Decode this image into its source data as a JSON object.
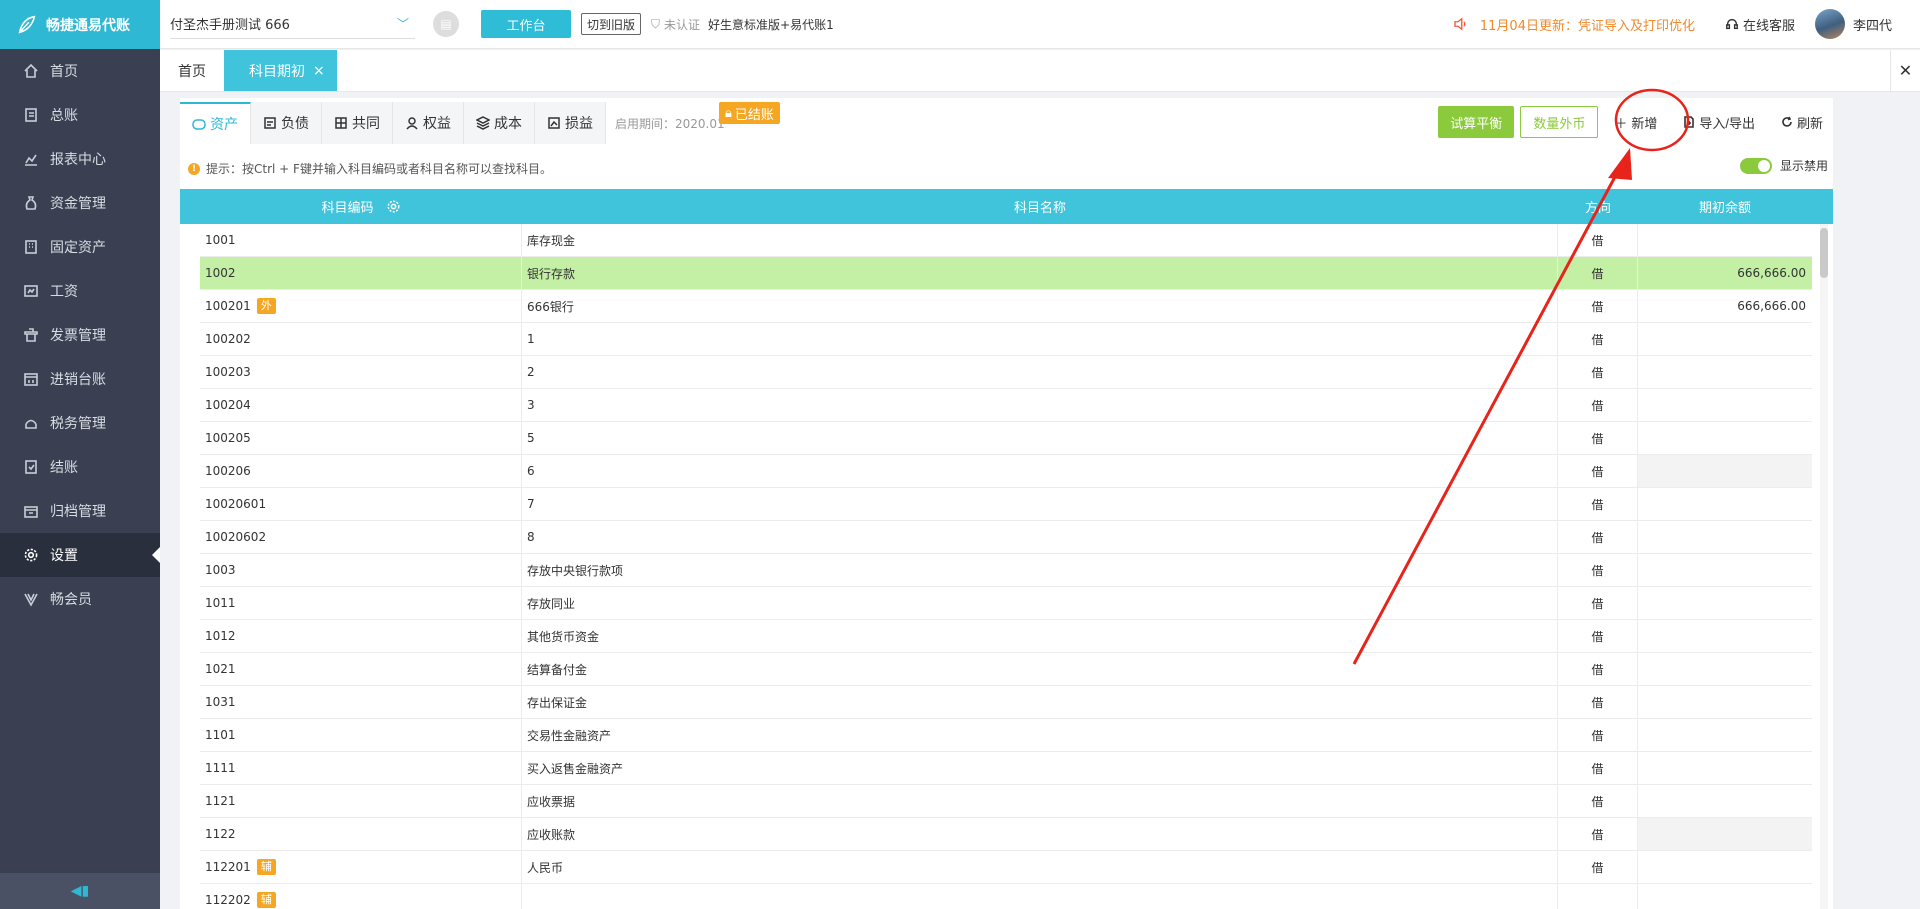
{
  "app": {
    "logo_text": "畅捷通易代账"
  },
  "sidebar": {
    "items": [
      {
        "label": "首页",
        "icon": "home-icon"
      },
      {
        "label": "总账",
        "icon": "ledger-icon"
      },
      {
        "label": "报表中心",
        "icon": "chart-icon"
      },
      {
        "label": "资金管理",
        "icon": "money-bag-icon"
      },
      {
        "label": "固定资产",
        "icon": "building-icon"
      },
      {
        "label": "工资",
        "icon": "payroll-icon"
      },
      {
        "label": "发票管理",
        "icon": "invoice-icon"
      },
      {
        "label": "进销台账",
        "icon": "register-icon"
      },
      {
        "label": "税务管理",
        "icon": "tax-icon"
      },
      {
        "label": "结账",
        "icon": "closing-icon"
      },
      {
        "label": "归档管理",
        "icon": "archive-icon"
      },
      {
        "label": "设置",
        "icon": "gear-icon",
        "active": true
      },
      {
        "label": "畅会员",
        "icon": "vip-icon"
      }
    ]
  },
  "topbar": {
    "company": "付圣杰手册测试 666",
    "workbench": "工作台",
    "old_version": "切到旧版",
    "cert_status": "未认证",
    "plan": "好生意标准版+易代账1",
    "notice": "11月04日更新：凭证导入及打印优化",
    "service": "在线客服",
    "user": "李四代"
  },
  "page_tabs": [
    {
      "label": "首页"
    },
    {
      "label": "科目期初",
      "active": true
    }
  ],
  "subtabs": [
    {
      "label": "资产",
      "active": true
    },
    {
      "label": "负债"
    },
    {
      "label": "共同"
    },
    {
      "label": "权益"
    },
    {
      "label": "成本"
    },
    {
      "label": "损益"
    }
  ],
  "period_label": "启用期间：2020.01",
  "closed_badge": "已结账",
  "actions": {
    "trial_balance": "试算平衡",
    "qty_fx": "数量外币",
    "add": "新增",
    "import_export": "导入/导出",
    "refresh": "刷新"
  },
  "hint": "提示：按Ctrl + F键并输入科目编码或者科目名称可以查找科目。",
  "toggle_label": "显示禁用",
  "table": {
    "headers": {
      "code": "科目编码",
      "name": "科目名称",
      "dir": "方向",
      "balance": "期初余额"
    },
    "rows": [
      {
        "code": "1001",
        "name": "库存现金",
        "dir": "借",
        "balance": ""
      },
      {
        "code": "1002",
        "name": "银行存款",
        "dir": "借",
        "balance": "666,666.00",
        "selected": true
      },
      {
        "code": "100201",
        "tag": "外",
        "name": "666银行",
        "dir": "借",
        "balance": "666,666.00"
      },
      {
        "code": "100202",
        "name": "1",
        "dir": "借",
        "balance": ""
      },
      {
        "code": "100203",
        "name": "2",
        "dir": "借",
        "balance": ""
      },
      {
        "code": "100204",
        "name": "3",
        "dir": "借",
        "balance": ""
      },
      {
        "code": "100205",
        "name": "5",
        "dir": "借",
        "balance": ""
      },
      {
        "code": "100206",
        "name": "6",
        "dir": "借",
        "balance": "",
        "shade": true
      },
      {
        "code": "10020601",
        "name": "7",
        "dir": "借",
        "balance": ""
      },
      {
        "code": "10020602",
        "name": "8",
        "dir": "借",
        "balance": ""
      },
      {
        "code": "1003",
        "name": "存放中央银行款项",
        "dir": "借",
        "balance": ""
      },
      {
        "code": "1011",
        "name": "存放同业",
        "dir": "借",
        "balance": ""
      },
      {
        "code": "1012",
        "name": "其他货币资金",
        "dir": "借",
        "balance": ""
      },
      {
        "code": "1021",
        "name": "结算备付金",
        "dir": "借",
        "balance": ""
      },
      {
        "code": "1031",
        "name": "存出保证金",
        "dir": "借",
        "balance": ""
      },
      {
        "code": "1101",
        "name": "交易性金融资产",
        "dir": "借",
        "balance": ""
      },
      {
        "code": "1111",
        "name": "买入返售金融资产",
        "dir": "借",
        "balance": ""
      },
      {
        "code": "1121",
        "name": "应收票据",
        "dir": "借",
        "balance": ""
      },
      {
        "code": "1122",
        "name": "应收账款",
        "dir": "借",
        "balance": "",
        "shade": true
      },
      {
        "code": "112201",
        "tag": "辅",
        "name": "人民币",
        "dir": "借",
        "balance": ""
      },
      {
        "code": "112202",
        "tag": "辅",
        "name": "",
        "dir": "",
        "balance": ""
      }
    ]
  },
  "colors": {
    "accent": "#40c4dc",
    "green": "#8bc93d",
    "orange": "#f5a623",
    "sidebar": "#3a4052",
    "annotation": "#e8231a"
  }
}
